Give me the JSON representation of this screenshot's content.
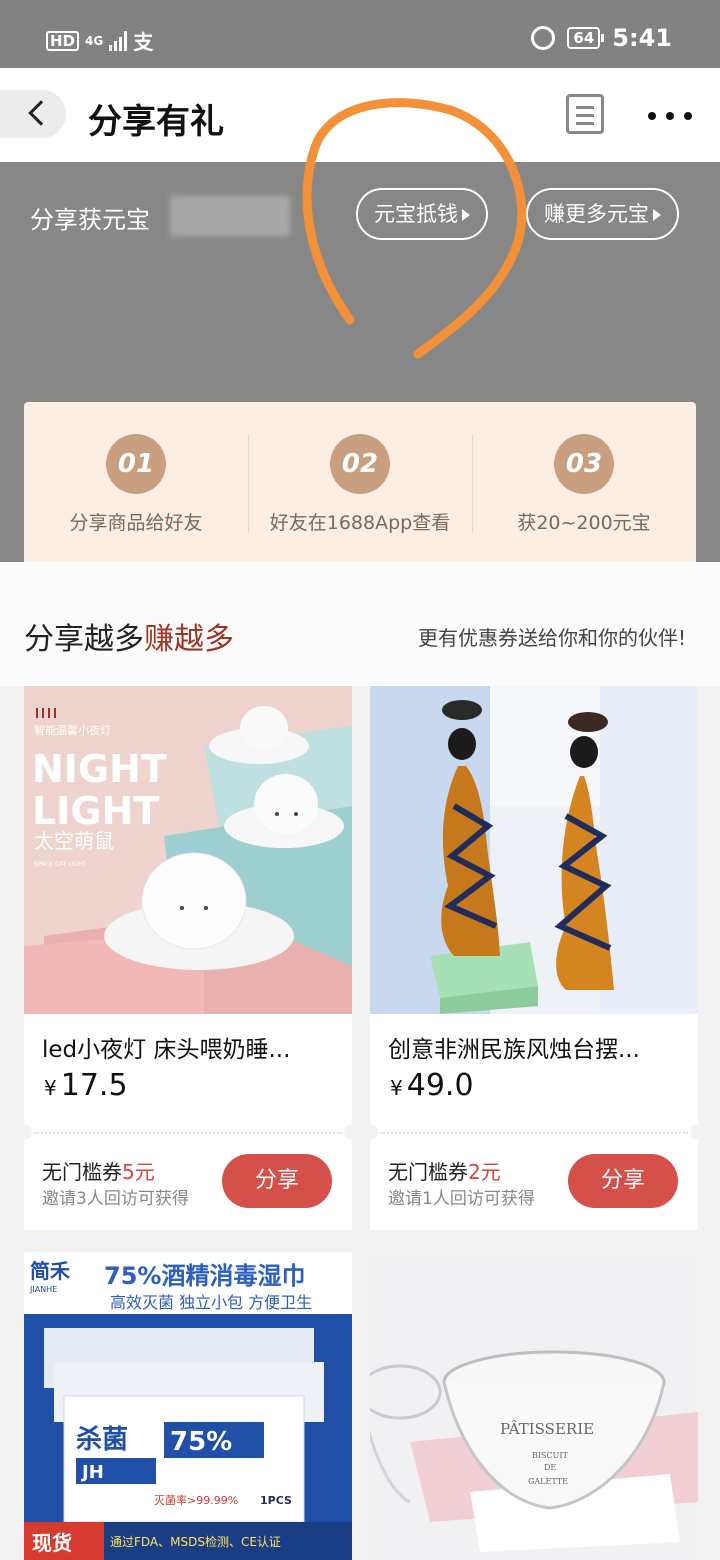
{
  "status_bar": {
    "network_hd": "HD",
    "network_type": "4G",
    "carrier_icon": "alipay-icon",
    "battery": "64",
    "time": "5:41"
  },
  "nav": {
    "title": "分享有礼"
  },
  "share_summary": {
    "label": "分享获元宝",
    "deduct_button": "元宝抵钱",
    "earn_more_button": "赚更多元宝"
  },
  "steps": [
    {
      "number": "01",
      "text": "分享商品给好友"
    },
    {
      "number": "02",
      "text": "好友在1688App查看"
    },
    {
      "number": "03",
      "text": "获20~200元宝"
    }
  ],
  "more_section": {
    "title_prefix": "分享越多",
    "title_highlight": "赚越多",
    "subtitle": "更有优惠券送给你和你的伙伴!"
  },
  "products": [
    {
      "name": "led小夜灯 床头喂奶睡...",
      "currency": "¥",
      "price": "17.5",
      "coupon_label": "无门槛券",
      "coupon_amount": "5元",
      "coupon_condition": "邀请3人回访可获得",
      "share_label": "分享",
      "image_text": {
        "headline1": "NIGHT",
        "headline2": "LIGHT",
        "cn_name": "太空萌鼠",
        "tagline": "智能温馨小夜灯",
        "small": "SPACE CAT LIGHT"
      }
    },
    {
      "name": "创意非洲民族风烛台摆...",
      "currency": "¥",
      "price": "49.0",
      "coupon_label": "无门槛券",
      "coupon_amount": "2元",
      "coupon_condition": "邀请1人回访可获得",
      "share_label": "分享"
    },
    {
      "image_text": {
        "brand": "简禾",
        "brand_en": "JIANHE",
        "headline": "75%酒精消毒湿巾",
        "sub": "高效灭菌 独立小包 方便卫生",
        "pack_kill": "杀菌",
        "pack_pct": "75%",
        "pack_jh": "JH",
        "pack_rate": "灭菌率>99.99%",
        "pack_pcs": "1PCS",
        "banner": "现货",
        "cert": "通过FDA、MSDS检测、CE认证"
      }
    },
    {
      "image_text": {
        "line1": "PÂTISSERIE",
        "line2": "BISCUIT",
        "line3": "DE",
        "line4": "GALETTE"
      }
    }
  ],
  "colors": {
    "accent_red": "#d6504a",
    "step_circle": "#c9a07f",
    "overlay_grey": "#878787",
    "annotation_orange": "#f39138"
  }
}
